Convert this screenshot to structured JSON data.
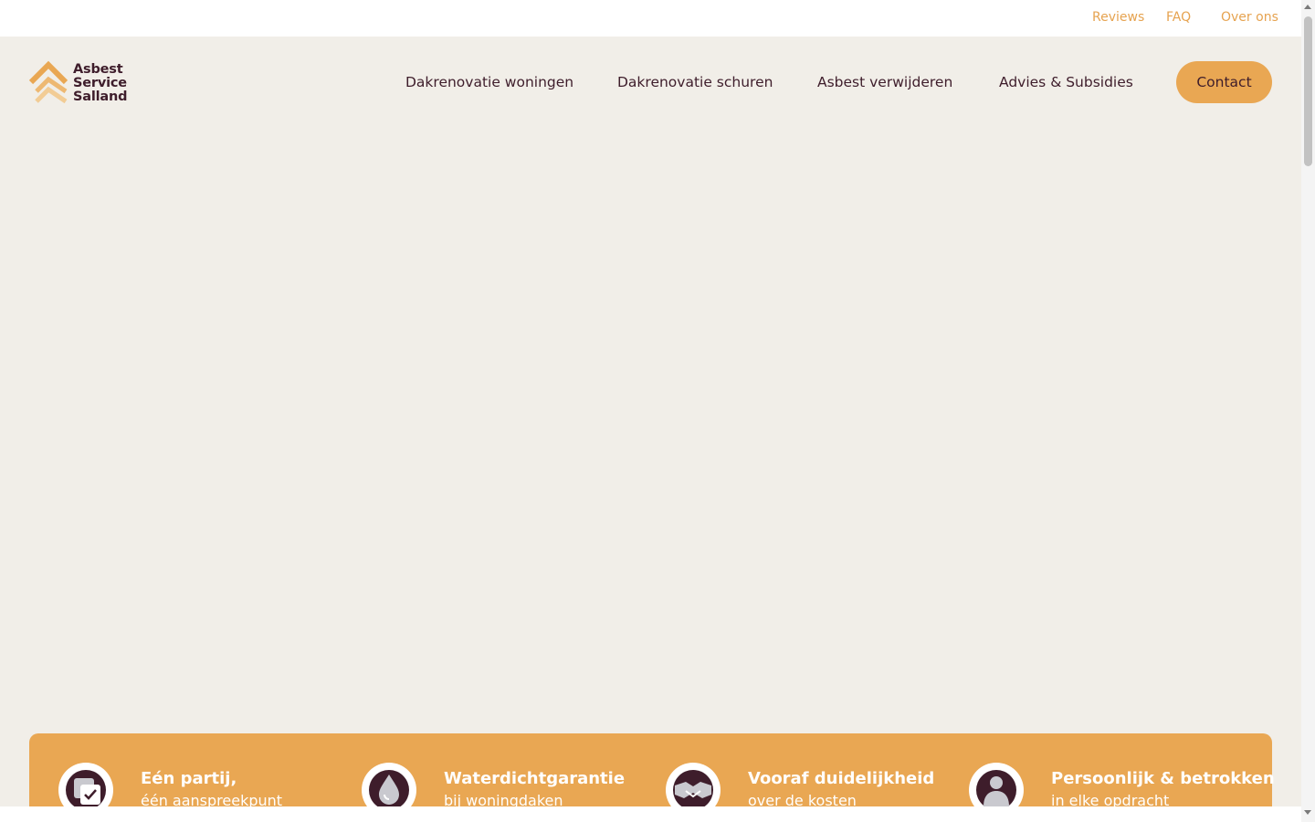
{
  "topbar": {
    "links": [
      "Reviews",
      "FAQ",
      "Over ons"
    ]
  },
  "logo": {
    "line1": "Asbest",
    "line2": "Service",
    "line3": "Salland"
  },
  "nav": {
    "items": [
      "Dakrenovatie woningen",
      "Dakrenovatie schuren",
      "Asbest verwijderen",
      "Advies & Subsidies"
    ],
    "contact_label": "Contact"
  },
  "usps": [
    {
      "title": "Eén partij,",
      "subtitle": "één aanspreekpunt",
      "icon": "document-check-icon"
    },
    {
      "title": "Waterdichtgarantie",
      "subtitle": "bij woningdaken",
      "icon": "water-drop-icon"
    },
    {
      "title": "Vooraf duidelijkheid",
      "subtitle": "over de kosten",
      "icon": "handshake-icon"
    },
    {
      "title": "Persoonlijk & betrokken",
      "subtitle": "in elke opdracht",
      "icon": "person-icon"
    }
  ],
  "colors": {
    "accent": "#e9a753",
    "brand_dark": "#3e1d2b",
    "background": "#f1eee8"
  }
}
